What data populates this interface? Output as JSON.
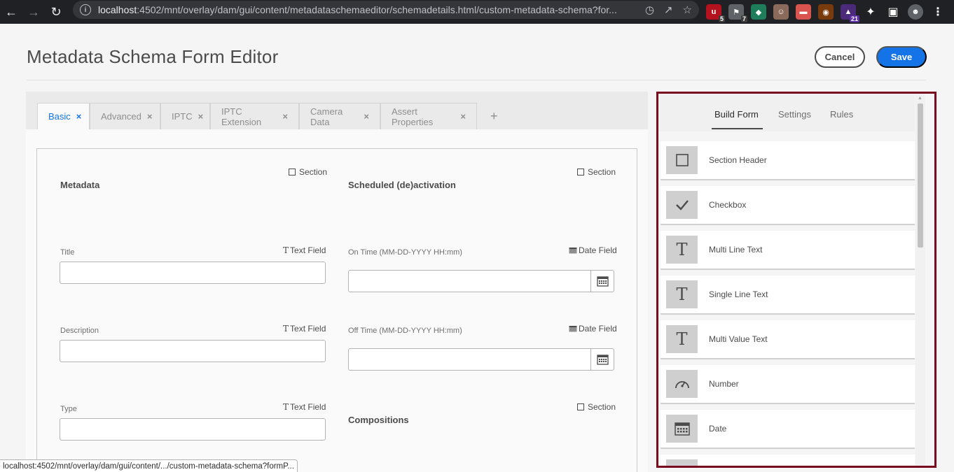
{
  "browser": {
    "url_host": "localhost",
    "url_path": ":4502/mnt/overlay/dam/gui/content/metadataschemaeditor/schemadetails.html/custom-metadata-schema?for...",
    "ext_badges": [
      "5",
      "7",
      "21"
    ],
    "status_url": "localhost:4502/mnt/overlay/dam/gui/content/.../custom-metadata-schema?formP..."
  },
  "header": {
    "title": "Metadata Schema Form Editor",
    "cancel_label": "Cancel",
    "save_label": "Save"
  },
  "tabs": [
    {
      "label": "Basic",
      "active": true
    },
    {
      "label": "Advanced"
    },
    {
      "label": "IPTC"
    },
    {
      "label": "IPTC Extension"
    },
    {
      "label": "Camera Data"
    },
    {
      "label": "Assert Properties"
    }
  ],
  "tab_add": "+",
  "form": {
    "left": {
      "section_tag": "Section",
      "section_title": "Metadata",
      "fields": [
        {
          "label": "Title",
          "type": "Text Field"
        },
        {
          "label": "Description",
          "type": "Text Field"
        },
        {
          "label": "Type",
          "type": "Text Field"
        }
      ]
    },
    "right": {
      "section_tag": "Section",
      "section_title": "Scheduled (de)activation",
      "fields": [
        {
          "label": "On Time (MM-DD-YYYY HH:mm)",
          "type": "Date Field"
        },
        {
          "label": "Off Time (MM-DD-YYYY HH:mm)",
          "type": "Date Field"
        }
      ],
      "section2_tag": "Section",
      "section2_title": "Compositions"
    }
  },
  "right_panel": {
    "tabs": [
      "Build Form",
      "Settings",
      "Rules"
    ],
    "active_tab": "Build Form",
    "components": [
      {
        "label": "Section Header",
        "icon": "square-icon"
      },
      {
        "label": "Checkbox",
        "icon": "checkmark-icon"
      },
      {
        "label": "Multi Line Text",
        "icon": "text-icon"
      },
      {
        "label": "Single Line Text",
        "icon": "text-icon"
      },
      {
        "label": "Multi Value Text",
        "icon": "text-icon"
      },
      {
        "label": "Number",
        "icon": "gauge-icon"
      },
      {
        "label": "Date",
        "icon": "calendar-icon"
      }
    ]
  },
  "colors": {
    "accent": "#1473e6",
    "highlight_border": "#7a0a1e"
  }
}
